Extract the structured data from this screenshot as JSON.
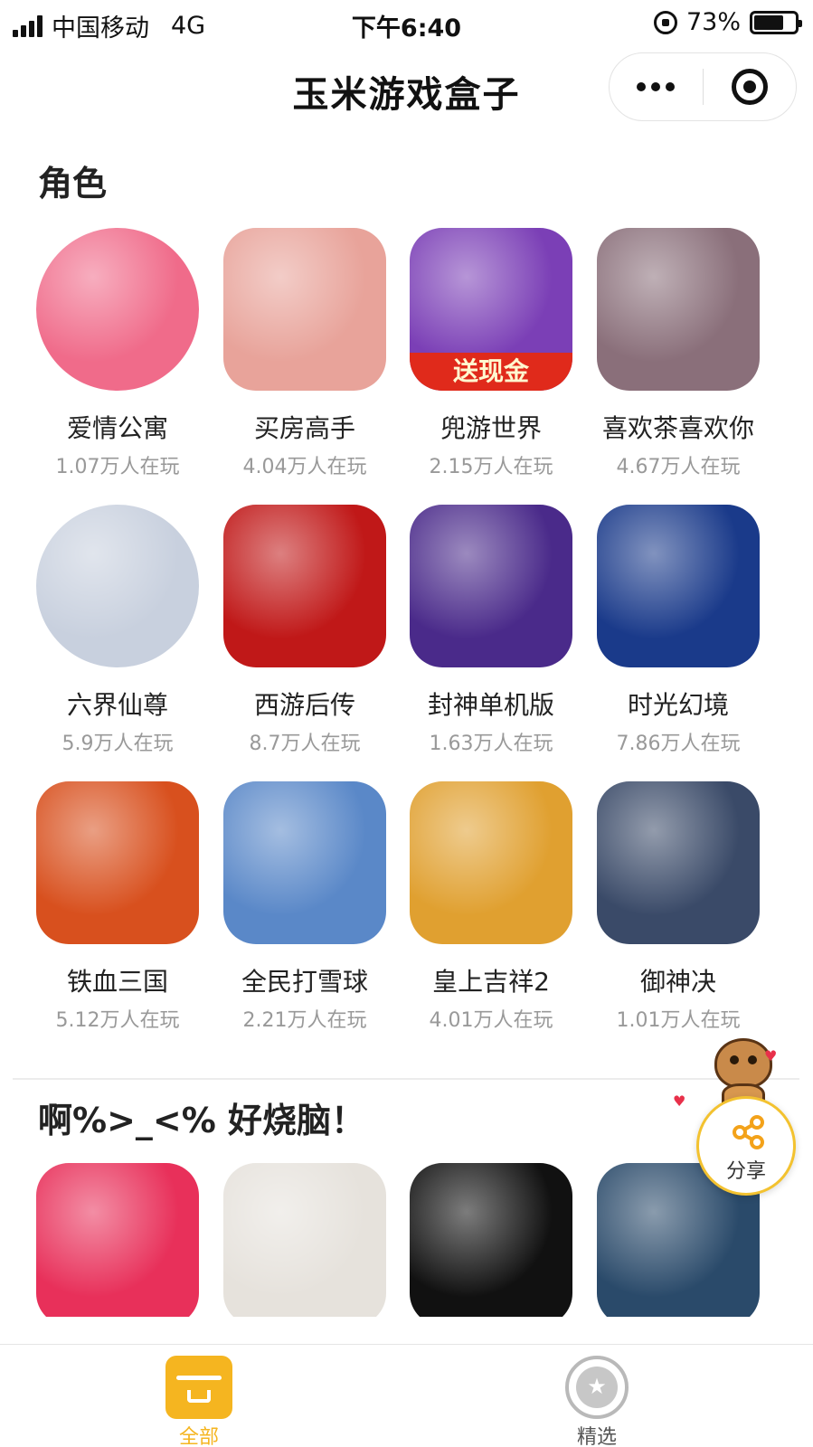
{
  "status_bar": {
    "carrier": "中国移动",
    "network": "4G",
    "time": "下午6:40",
    "battery": "73%",
    "battery_level": 0.73
  },
  "nav": {
    "title": "玉米游戏盒子",
    "more_icon": "more-dots-icon",
    "close_icon": "target-circle-icon"
  },
  "sections": [
    {
      "title": "角色",
      "games": [
        {
          "name": "爱情公寓",
          "players": "1.07万人在玩",
          "color": "#f06b8a",
          "shape": "round"
        },
        {
          "name": "买房高手",
          "players": "4.04万人在玩",
          "color": "#e8a39a",
          "shape": "square"
        },
        {
          "name": "兜游世界",
          "players": "2.15万人在玩",
          "color": "#7b3fb6",
          "shape": "square",
          "badge": "送现金"
        },
        {
          "name": "喜欢茶喜欢你",
          "players": "4.67万人在玩",
          "color": "#8a6f7a",
          "shape": "square"
        },
        {
          "name": "六界仙尊",
          "players": "5.9万人在玩",
          "color": "#c8d0de",
          "shape": "round"
        },
        {
          "name": "西游后传",
          "players": "8.7万人在玩",
          "color": "#c01818",
          "shape": "square"
        },
        {
          "name": "封神单机版",
          "players": "1.63万人在玩",
          "color": "#4a2a8a",
          "shape": "square"
        },
        {
          "name": "时光幻境",
          "players": "7.86万人在玩",
          "color": "#1a3a8a",
          "shape": "square"
        },
        {
          "name": "铁血三国",
          "players": "5.12万人在玩",
          "color": "#d8501e",
          "shape": "square"
        },
        {
          "name": "全民打雪球",
          "players": "2.21万人在玩",
          "color": "#5a88c8",
          "shape": "square"
        },
        {
          "name": "皇上吉祥2",
          "players": "4.01万人在玩",
          "color": "#e0a030",
          "shape": "square"
        },
        {
          "name": "御神决",
          "players": "1.01万人在玩",
          "color": "#3a4a68",
          "shape": "square"
        }
      ]
    },
    {
      "title": "啊%>_<% 好烧脑！",
      "games": [
        {
          "color": "#e8305a",
          "shape": "square"
        },
        {
          "color": "#e6e2dc",
          "shape": "square"
        },
        {
          "color": "#111111",
          "shape": "square"
        },
        {
          "color": "#2a4a6a",
          "shape": "square"
        }
      ]
    }
  ],
  "share": {
    "label": "分享",
    "accent": "#f3c230"
  },
  "tabbar": {
    "tabs": [
      {
        "label": "全部",
        "active": true,
        "color": "#f5b520"
      },
      {
        "label": "精选",
        "active": false,
        "color": "#555555"
      }
    ]
  }
}
